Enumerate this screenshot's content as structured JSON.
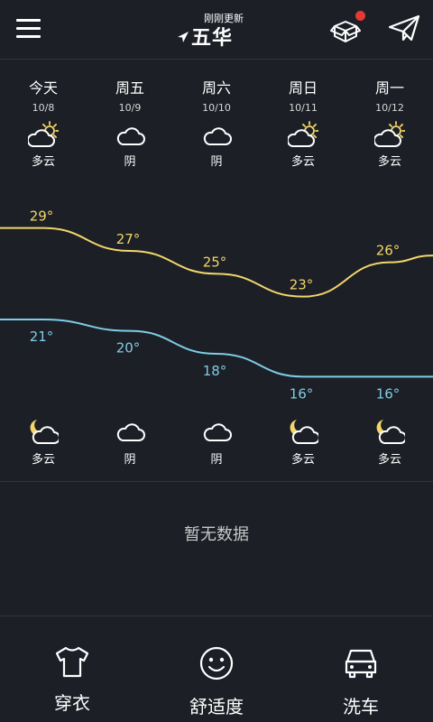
{
  "header": {
    "update_status": "刚刚更新",
    "city": "五华",
    "icons": {
      "menu": "menu-icon",
      "location": "location-arrow-icon",
      "box": "box-icon",
      "send": "send-icon"
    },
    "badge_color": "#e53935"
  },
  "forecast": [
    {
      "day": "今天",
      "date": "10/8",
      "day_condition": "多云",
      "day_icon": "partly-cloudy-day-icon",
      "high": "29°",
      "low": "21°",
      "night_condition": "多云",
      "night_icon": "partly-cloudy-night-icon"
    },
    {
      "day": "周五",
      "date": "10/9",
      "day_condition": "阴",
      "day_icon": "cloudy-icon",
      "high": "27°",
      "low": "20°",
      "night_condition": "阴",
      "night_icon": "cloudy-icon"
    },
    {
      "day": "周六",
      "date": "10/10",
      "day_condition": "阴",
      "day_icon": "cloudy-icon",
      "high": "25°",
      "low": "18°",
      "night_condition": "阴",
      "night_icon": "cloudy-icon"
    },
    {
      "day": "周日",
      "date": "10/11",
      "day_condition": "多云",
      "day_icon": "partly-cloudy-day-icon",
      "high": "23°",
      "low": "16°",
      "night_condition": "多云",
      "night_icon": "partly-cloudy-night-icon"
    },
    {
      "day": "周一",
      "date": "10/12",
      "day_condition": "多云",
      "day_icon": "partly-cloudy-day-icon",
      "high": "26°",
      "low": "16°",
      "night_condition": "多云",
      "night_icon": "partly-cloudy-night-icon"
    }
  ],
  "chart_data": {
    "type": "line",
    "categories": [
      "今天",
      "周五",
      "周六",
      "周日",
      "周一"
    ],
    "series": [
      {
        "values": [
          29,
          27,
          25,
          23,
          26
        ],
        "color": "#f2d66b"
      },
      {
        "values": [
          21,
          20,
          18,
          16,
          16
        ],
        "color": "#7fcde6"
      }
    ]
  },
  "life_index": {
    "empty_text": "暂无数据"
  },
  "bottom_tabs": [
    {
      "label": "穿衣",
      "icon": "tshirt-icon"
    },
    {
      "label": "舒适度",
      "icon": "smiley-icon"
    },
    {
      "label": "洗车",
      "icon": "car-icon"
    }
  ],
  "colors": {
    "background": "#1c1f26",
    "high_line": "#f2d66b",
    "low_line": "#7fcde6",
    "sun": "#f2d66b"
  }
}
